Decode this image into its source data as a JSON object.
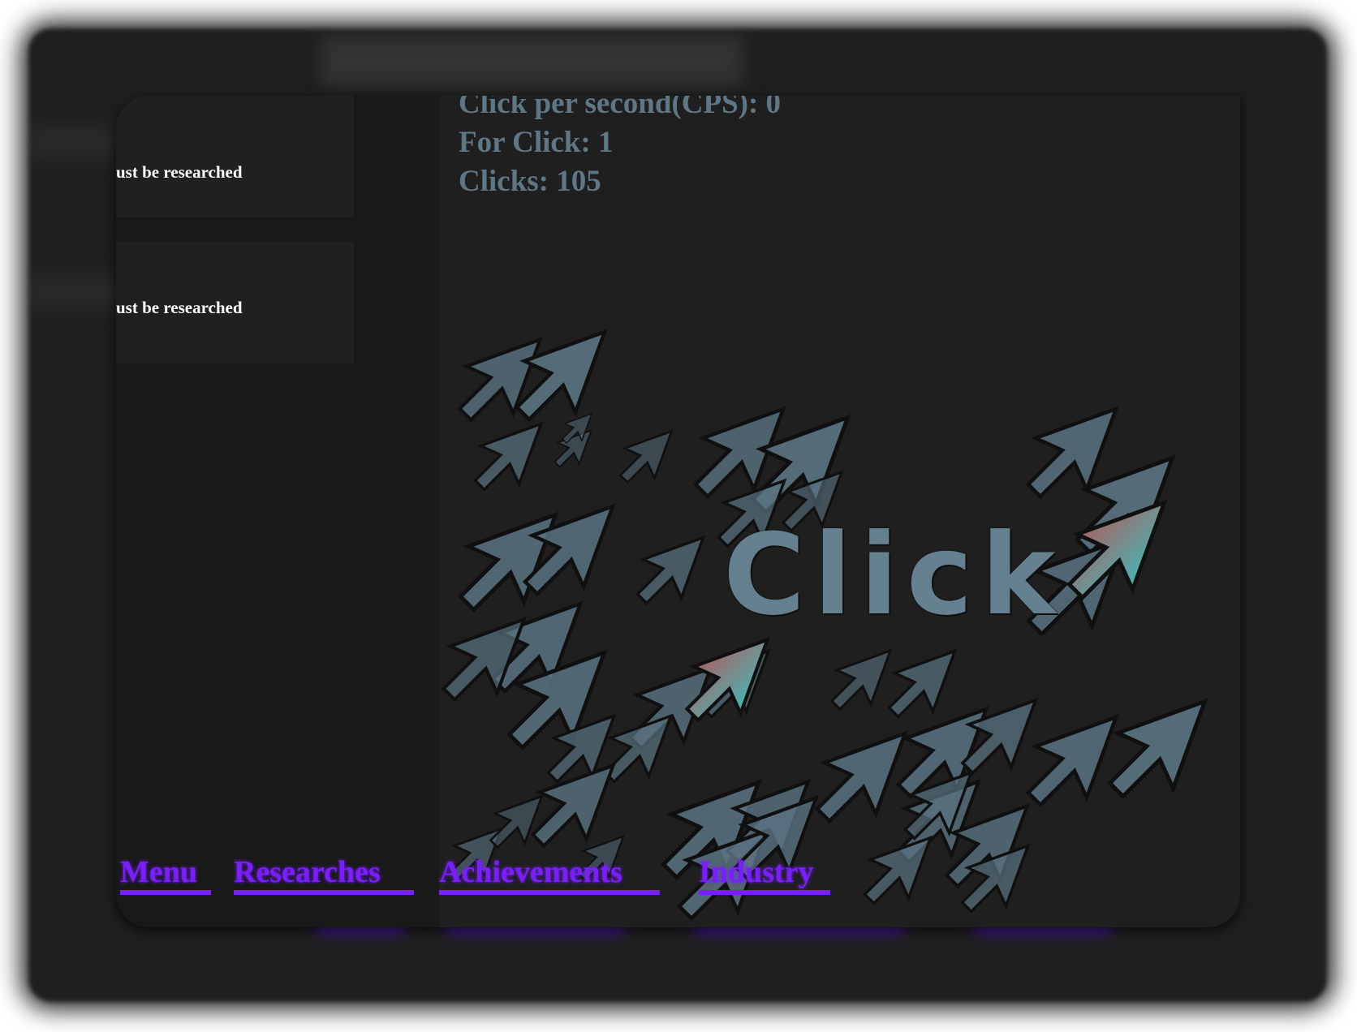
{
  "stats": {
    "cps": "Click per second(CPS): 0",
    "for_click": "For Click: 1",
    "clicks": "Clicks: 105"
  },
  "sidebar": {
    "research_cards": [
      {
        "text": "ust be researched"
      },
      {
        "text": "ust be researched"
      }
    ]
  },
  "click_button": {
    "label": "Click"
  },
  "nav": {
    "menu": "Menu",
    "researches": "Researches",
    "achievements": "Achievements",
    "industry": "Industry"
  },
  "colors": {
    "background": "#1f1f1f",
    "sidebar": "#191919",
    "stat_text": "#5f7785",
    "nav_accent": "#7a1eff",
    "cursor_fill": "#5a7382"
  }
}
